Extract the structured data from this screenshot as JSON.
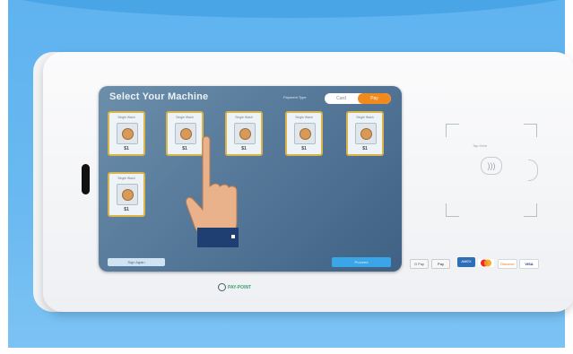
{
  "screen": {
    "title": "Select Your Machine",
    "toggle_label": "Payment Type",
    "toggle_options": [
      "Card",
      "Pay"
    ],
    "machines": [
      {
        "label": "Single Wash",
        "price": "$1"
      },
      {
        "label": "Single Wash",
        "price": "$1"
      },
      {
        "label": "Single Wash",
        "price": "$1"
      },
      {
        "label": "Single Wash",
        "price": "$1"
      },
      {
        "label": "Single Wash",
        "price": "$1"
      },
      {
        "label": "Single Wash",
        "price": "$1"
      }
    ],
    "sign_again_label": "Sign Again",
    "proceed_label": "Proceed"
  },
  "reader": {
    "tap_text": "Tap Here",
    "contactless_icon": "contactless-icon"
  },
  "payment_methods": [
    "G Pay",
    "Pay",
    "AMEX",
    "Mastercard",
    "Discover",
    "VISA"
  ],
  "brand": {
    "name": "PAY-POINT"
  },
  "colors": {
    "background": "#5fb3ef",
    "accent_orange": "#f08a1c",
    "accent_blue": "#3aa5e7",
    "card_border": "#d9b54a"
  }
}
